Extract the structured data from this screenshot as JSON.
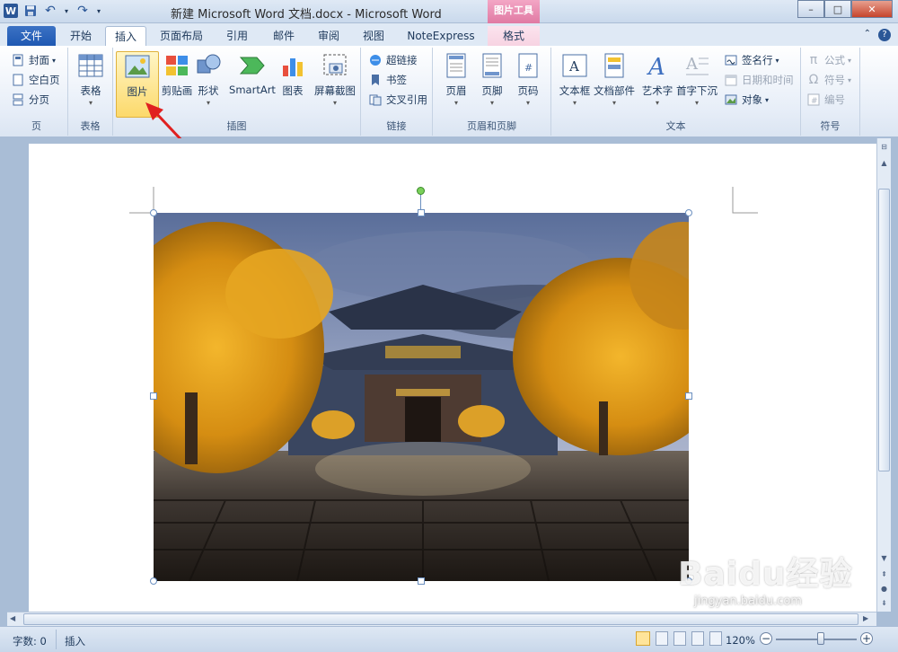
{
  "window": {
    "title": "新建 Microsoft Word 文档.docx - Microsoft Word",
    "context_tool": "图片工具",
    "minimize": "–",
    "maximize": "□",
    "close": "✕"
  },
  "qat": {
    "logo": "W",
    "undo": "↶",
    "redo": "↷",
    "customize": "▾"
  },
  "tabs": [
    {
      "label": "文件"
    },
    {
      "label": "开始"
    },
    {
      "label": "插入"
    },
    {
      "label": "页面布局"
    },
    {
      "label": "引用"
    },
    {
      "label": "邮件"
    },
    {
      "label": "审阅"
    },
    {
      "label": "视图"
    },
    {
      "label": "NoteExpress"
    },
    {
      "label": "格式"
    }
  ],
  "ribbon": {
    "pages": {
      "label": "页",
      "cover": "封面",
      "blank": "空白页",
      "break": "分页"
    },
    "tables": {
      "label": "表格",
      "table": "表格"
    },
    "illustrations": {
      "label": "插图",
      "picture": "图片",
      "clipart": "剪贴画",
      "shapes": "形状",
      "smartart": "SmartArt",
      "chart": "图表",
      "screenshot": "屏幕截图"
    },
    "links": {
      "label": "链接",
      "hyperlink": "超链接",
      "bookmark": "书签",
      "crossref": "交叉引用"
    },
    "headerfooter": {
      "label": "页眉和页脚",
      "header": "页眉",
      "footer": "页脚",
      "pagenum": "页码"
    },
    "text": {
      "label": "文本",
      "textbox": "文本框",
      "quickparts": "文档部件",
      "wordart": "艺术字",
      "dropcap": "首字下沉",
      "sigline": "签名行",
      "datetime": "日期和时间",
      "object": "对象"
    },
    "symbols": {
      "label": "符号",
      "equation": "公式",
      "symbol": "符号",
      "number": "编号"
    }
  },
  "status": {
    "wordcount": "字数: 0",
    "mode": "插入",
    "zoom": "120%",
    "zoom_level": 0.55
  },
  "watermark": {
    "brand": "Baidu经验",
    "url": "jingyan.baidu.com"
  },
  "colors": {
    "accent": "#2b5797",
    "context_tab": "#e07aa3",
    "highlight": "#fcd96b"
  }
}
